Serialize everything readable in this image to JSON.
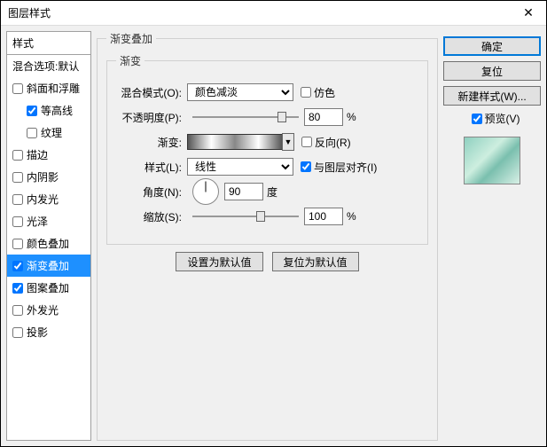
{
  "window": {
    "title": "图层样式"
  },
  "styles_panel": {
    "header": "样式",
    "blend_options": "混合选项:默认",
    "items": [
      {
        "label": "斜面和浮雕",
        "checked": false,
        "indent": false
      },
      {
        "label": "等高线",
        "checked": true,
        "indent": true
      },
      {
        "label": "纹理",
        "checked": false,
        "indent": true
      },
      {
        "label": "描边",
        "checked": false,
        "indent": false
      },
      {
        "label": "内阴影",
        "checked": false,
        "indent": false
      },
      {
        "label": "内发光",
        "checked": false,
        "indent": false
      },
      {
        "label": "光泽",
        "checked": false,
        "indent": false
      },
      {
        "label": "颜色叠加",
        "checked": false,
        "indent": false
      },
      {
        "label": "渐变叠加",
        "checked": true,
        "indent": false,
        "selected": true
      },
      {
        "label": "图案叠加",
        "checked": true,
        "indent": false
      },
      {
        "label": "外发光",
        "checked": false,
        "indent": false
      },
      {
        "label": "投影",
        "checked": false,
        "indent": false
      }
    ]
  },
  "gradient_overlay": {
    "group_title": "渐变叠加",
    "inner_title": "渐变",
    "blend_mode_label": "混合模式(O):",
    "blend_mode_value": "颜色减淡",
    "dither_label": "仿色",
    "dither_checked": false,
    "opacity_label": "不透明度(P):",
    "opacity_value": "80",
    "opacity_unit": "%",
    "gradient_label": "渐变:",
    "reverse_label": "反向(R)",
    "reverse_checked": false,
    "style_label": "样式(L):",
    "style_value": "线性",
    "align_label": "与图层对齐(I)",
    "align_checked": true,
    "angle_label": "角度(N):",
    "angle_value": "90",
    "angle_unit": "度",
    "scale_label": "缩放(S):",
    "scale_value": "100",
    "scale_unit": "%",
    "make_default": "设置为默认值",
    "reset_default": "复位为默认值"
  },
  "buttons": {
    "ok": "确定",
    "cancel": "复位",
    "new_style": "新建样式(W)...",
    "preview_label": "预览(V)",
    "preview_checked": true
  }
}
